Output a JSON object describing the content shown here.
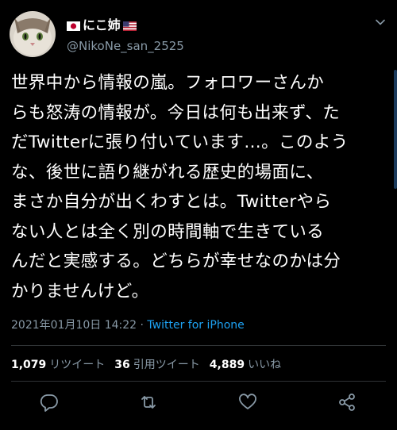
{
  "tweet": {
    "display_name": "にこ姉",
    "handle": "@NikoNe_san_2525",
    "text_lines": [
      "世界中から情報の嵐。フォロワーさんか",
      "らも怒涛の情報が。今日は何も出来ず、た",
      "だTwitterに張り付いています…。このよう",
      "な、後世に語り継がれる歴史的場面に、",
      "まさか自分が出くわすとは。Twitterやら",
      "ない人とは全く別の時間軸で生きている",
      "んだと実感する。どちらが幸せなのかは分",
      "かりませんけど。"
    ],
    "timestamp": "2021年01月10日 14:22",
    "separator": " · ",
    "source": "Twitter for iPhone",
    "stats": {
      "retweets_count": "1,079",
      "retweets_label": "リツイート",
      "quotes_count": "36",
      "quotes_label": "引用ツイート",
      "likes_count": "4,889",
      "likes_label": "いいね"
    },
    "icons": {
      "flag_left": "japan-flag-icon",
      "flag_right": "us-flag-icon",
      "caret": "chevron-down-icon",
      "reply": "reply-icon",
      "retweet": "retweet-icon",
      "like": "heart-icon",
      "share": "share-icon"
    }
  },
  "colors": {
    "background": "#000000",
    "text": "#ffffff",
    "secondary": "#8899a6",
    "link": "#1da1f2",
    "divider": "#2f3336"
  }
}
